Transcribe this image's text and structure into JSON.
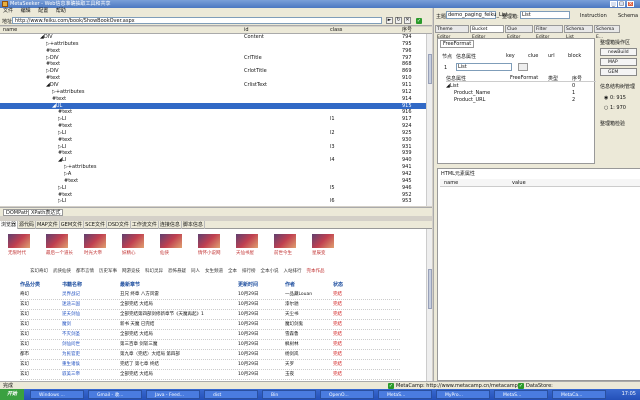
{
  "window": {
    "title": "MetaSeeker - Web信息准确抽取工具和共享",
    "min": "_",
    "max": "□",
    "close": "×"
  },
  "menu": [
    "文件",
    "编辑",
    "配置",
    "帮助"
  ],
  "address": {
    "label": "地址:",
    "value": "http://www.feiku.com/book/ShowBookOver.aspx",
    "go": "►"
  },
  "tree": {
    "headers": {
      "name": "name",
      "id": "id",
      "class": "class",
      "seq": "序号"
    },
    "rows": [
      {
        "indent": 40,
        "name": "◢DIV",
        "id": "Content",
        "cls": "",
        "seq": "794",
        "sel": false
      },
      {
        "indent": 46,
        "name": "▷+attributes",
        "id": "",
        "cls": "",
        "seq": "795",
        "sel": false
      },
      {
        "indent": 46,
        "name": "#text",
        "id": "",
        "cls": "",
        "seq": "796",
        "sel": false
      },
      {
        "indent": 46,
        "name": "▷DIV",
        "id": "CrlTitle",
        "cls": "",
        "seq": "797",
        "sel": false
      },
      {
        "indent": 46,
        "name": "#text",
        "id": "",
        "cls": "",
        "seq": "868",
        "sel": false
      },
      {
        "indent": 46,
        "name": "▷DIV",
        "id": "CrlotTitle",
        "cls": "",
        "seq": "869",
        "sel": false
      },
      {
        "indent": 46,
        "name": "#text",
        "id": "",
        "cls": "",
        "seq": "910",
        "sel": false
      },
      {
        "indent": 46,
        "name": "◢DIV",
        "id": "CrlistText",
        "cls": "",
        "seq": "911",
        "sel": false
      },
      {
        "indent": 52,
        "name": "▷+attributes",
        "id": "",
        "cls": "",
        "seq": "912",
        "sel": false
      },
      {
        "indent": 52,
        "name": "#text",
        "id": "",
        "cls": "",
        "seq": "914",
        "sel": false
      },
      {
        "indent": 52,
        "name": "◢UL",
        "id": "",
        "cls": "",
        "seq": "915",
        "sel": true
      },
      {
        "indent": 58,
        "name": "#text",
        "id": "",
        "cls": "",
        "seq": "916",
        "sel": false
      },
      {
        "indent": 58,
        "name": "▷LI",
        "id": "",
        "cls": "l1",
        "seq": "917",
        "sel": false
      },
      {
        "indent": 58,
        "name": "#text",
        "id": "",
        "cls": "",
        "seq": "924",
        "sel": false
      },
      {
        "indent": 58,
        "name": "▷LI",
        "id": "",
        "cls": "l2",
        "seq": "925",
        "sel": false
      },
      {
        "indent": 58,
        "name": "#text",
        "id": "",
        "cls": "",
        "seq": "930",
        "sel": false
      },
      {
        "indent": 58,
        "name": "▷LI",
        "id": "",
        "cls": "l3",
        "seq": "931",
        "sel": false
      },
      {
        "indent": 58,
        "name": "#text",
        "id": "",
        "cls": "",
        "seq": "939",
        "sel": false
      },
      {
        "indent": 58,
        "name": "◢LI",
        "id": "",
        "cls": "l4",
        "seq": "940",
        "sel": false
      },
      {
        "indent": 64,
        "name": "▷+attributes",
        "id": "",
        "cls": "",
        "seq": "941",
        "sel": false
      },
      {
        "indent": 64,
        "name": "▷A",
        "id": "",
        "cls": "",
        "seq": "942",
        "sel": false
      },
      {
        "indent": 64,
        "name": "#text",
        "id": "",
        "cls": "",
        "seq": "945",
        "sel": false
      },
      {
        "indent": 58,
        "name": "▷LI",
        "id": "",
        "cls": "l5",
        "seq": "946",
        "sel": false
      },
      {
        "indent": 58,
        "name": "#text",
        "id": "",
        "cls": "",
        "seq": "952",
        "sel": false
      },
      {
        "indent": 58,
        "name": "▷LI",
        "id": "",
        "cls": "l6",
        "seq": "953",
        "sel": false
      }
    ]
  },
  "xpath": {
    "tab1": "DOMPath",
    "tab2": "XPath表达式"
  },
  "bottom_tabs": [
    "浏览器",
    "源代码",
    "MAP文件",
    "GEM文件",
    "SCE文件",
    "DSD文件",
    "工作流文件",
    "连接信息",
    "脚本信息"
  ],
  "web": {
    "thumbs": [
      {
        "cap": "无限时代"
      },
      {
        "cap": "最后一个道长"
      },
      {
        "cap": "时光大帝"
      },
      {
        "cap": "妖精心"
      },
      {
        "cap": "仙侠"
      },
      {
        "cap": "情怀小说网"
      },
      {
        "cap": "天仙书屋"
      },
      {
        "cap": "前世今生"
      },
      {
        "cap": "星辰变"
      }
    ],
    "nav": [
      "玄幻奇幻",
      "武侠仙侠",
      "都市言情",
      "历史军事",
      "网游竞技",
      "科幻灵异",
      "恐怖悬疑",
      "同人",
      "女生频道",
      "全本",
      "排行榜",
      "全本小说",
      "入站排行",
      "完本作品"
    ],
    "headers": [
      "作品分类",
      "书籍名称",
      "最新章节",
      "更新时间",
      "作者",
      "状态"
    ],
    "rows": [
      [
        "奇幻",
        "灵界战记",
        "丑兄 终章 八方风雷",
        "10月29日",
        "一品藏Louan",
        "完结"
      ],
      [
        "玄幻",
        "迷途三国",
        "全部完结 大结局",
        "10月29日",
        "漆尔驰",
        "完结"
      ],
      [
        "玄幻",
        "逆夭剑仙",
        "全部完结第四部剑修新章节《天魔再起》1",
        "10月29日",
        "天尘书",
        "完结"
      ],
      [
        "玄幻",
        "魔剑",
        "新书 天魔 已完结",
        "10月29日",
        "魔幻剑鬼",
        "完结"
      ],
      [
        "玄幻",
        "不灭剑圣",
        "全部完结 大结局",
        "10月29日",
        "雪森鲁",
        "完结"
      ],
      [
        "玄幻",
        "剑仙问世",
        "第三百章 剑斩三魔",
        "10月29日",
        "枫树林",
        "完结"
      ],
      [
        "都市",
        "为民官吏",
        "第九章（完结）大结局 第四部",
        "10月29日",
        "杨剑岚",
        "完结"
      ],
      [
        "玄幻",
        "重生诸侯",
        "完结了 第七章 终结",
        "10月29日",
        "天罗",
        "完结"
      ],
      [
        "玄幻",
        "驭美三帝",
        "全部完结 大结局",
        "10月29日",
        "玉夜",
        "完结"
      ],
      [
        "玄幻",
        "混沌大帝",
        "终章 王者归来",
        "10月29日",
        "梦远",
        "完结"
      ]
    ]
  },
  "status": {
    "left": "完成",
    "mc_label": "MetaCamp: http://www.metacamp.cn/metacamp/",
    "ds_label": "DataStore: http://www.metacamp.cn/datastore/"
  },
  "taskbar": {
    "start": "开始",
    "tasks": [
      "Windows ...",
      "Gmail - 收...",
      "Java - Feed...",
      "dist",
      "Bin",
      "OpenO...",
      "MetaS...",
      "MyPro...",
      "MetaS...",
      "MetaCa..."
    ],
    "clock": "17:05"
  },
  "right": {
    "theme_label": "主题:",
    "theme_value": "demo_paging_feiku_List",
    "bucket_label": "整理箱:",
    "bucket_value": "List",
    "instruction": "Instruction",
    "schema": "Schema",
    "tabs": [
      "Theme Editor",
      "Bucket Editor",
      "Clue Editor",
      "Filter Editor",
      "Schema List",
      "Schema E..."
    ],
    "ff_label": "FreeFormat",
    "ff_cols": [
      "节点",
      "信息属性",
      "key",
      "clue",
      "url",
      "block"
    ],
    "ff_input": "List",
    "ff_input_num": "1",
    "tbl_headers": [
      "信息属性",
      "FreeFormat",
      "类型",
      "序号"
    ],
    "tbl_rows": [
      {
        "name": "◢List",
        "ff": "",
        "type": "",
        "seq": "0"
      },
      {
        "name": "Product_Name",
        "ff": "",
        "type": "",
        "seq": "1"
      },
      {
        "name": "Product_URL",
        "ff": "",
        "type": "",
        "seq": "2"
      }
    ],
    "side": {
      "title": "整理箱操作区",
      "b1": "newBuild",
      "b2": "MAP",
      "b3": "GEM",
      "sec2": "信息结构树管理",
      "r1": "0: 915",
      "r2": "1: 970",
      "sec3": "整理箱检验"
    },
    "html_title": "HTML元素属性",
    "html_cols": [
      "name",
      "value"
    ]
  }
}
